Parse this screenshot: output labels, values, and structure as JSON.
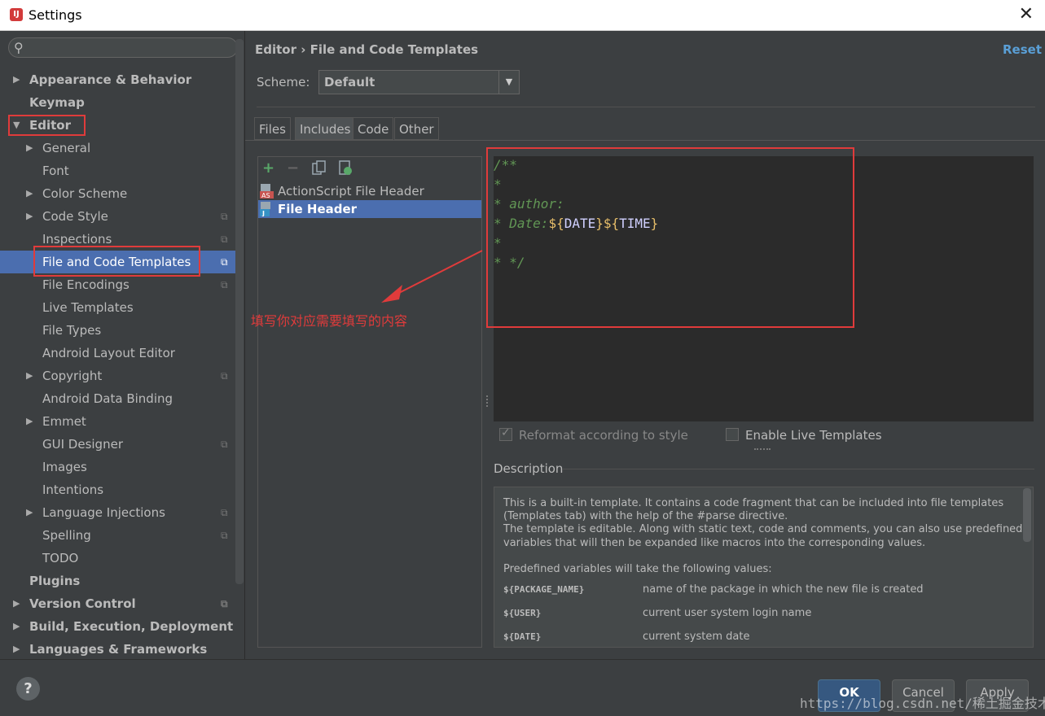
{
  "window": {
    "title": "Settings",
    "close_glyph": "✕"
  },
  "search": {
    "placeholder": ""
  },
  "sidebar": {
    "items": [
      {
        "label": "Appearance & Behavior",
        "arrow": "▶"
      },
      {
        "label": "Keymap"
      },
      {
        "label": "Editor",
        "arrow": "▼"
      },
      {
        "label": "General",
        "arrow": "▶"
      },
      {
        "label": "Font"
      },
      {
        "label": "Color Scheme",
        "arrow": "▶"
      },
      {
        "label": "Code Style",
        "arrow": "▶"
      },
      {
        "label": "Inspections"
      },
      {
        "label": "File and Code Templates"
      },
      {
        "label": "File Encodings"
      },
      {
        "label": "Live Templates"
      },
      {
        "label": "File Types"
      },
      {
        "label": "Android Layout Editor"
      },
      {
        "label": "Copyright",
        "arrow": "▶"
      },
      {
        "label": "Android Data Binding"
      },
      {
        "label": "Emmet",
        "arrow": "▶"
      },
      {
        "label": "GUI Designer"
      },
      {
        "label": "Images"
      },
      {
        "label": "Intentions"
      },
      {
        "label": "Language Injections",
        "arrow": "▶"
      },
      {
        "label": "Spelling"
      },
      {
        "label": "TODO"
      },
      {
        "label": "Plugins"
      },
      {
        "label": "Version Control",
        "arrow": "▶"
      },
      {
        "label": "Build, Execution, Deployment",
        "arrow": "▶"
      },
      {
        "label": "Languages & Frameworks",
        "arrow": "▶"
      }
    ]
  },
  "header": {
    "breadcrumb": "Editor › File and Code Templates",
    "reset_label": "Reset"
  },
  "scheme": {
    "label": "Scheme:",
    "value": "Default"
  },
  "tabs": [
    {
      "label": "Files"
    },
    {
      "label": "Includes"
    },
    {
      "label": "Code"
    },
    {
      "label": "Other"
    }
  ],
  "template_list": [
    {
      "label": "ActionScript File Header",
      "icon_text": "AS"
    },
    {
      "label": "File Header",
      "icon_text": "J"
    }
  ],
  "editor": {
    "line1": "/**",
    "line2": "*",
    "line3": "* author:",
    "line4_prefix": "* Date:",
    "line4_var1": "${",
    "line4_name1": "DATE",
    "line4_close1": "}",
    "line4_var2": "${",
    "line4_name2": "TIME",
    "line4_close2": "}",
    "line5": "*",
    "line6": "* */"
  },
  "options": {
    "reformat_label": "Reformat according to style",
    "live_templates_label": "Enable Live Templates"
  },
  "description": {
    "title": "Description",
    "p1": "This is a built-in template. It contains a code fragment that can be included into file templates",
    "p2": "(Templates tab) with the help of the #parse directive.",
    "p3": "The template is editable. Along with static text, code and comments, you can also use predefined",
    "p4": "variables that will then be expanded like macros into the corresponding values.",
    "p5": "Predefined variables will take the following values:",
    "vars": [
      {
        "key": "${PACKAGE_NAME}",
        "desc": "name of the package in which the new file is created"
      },
      {
        "key": "${USER}",
        "desc": "current user system login name"
      },
      {
        "key": "${DATE}",
        "desc": "current system date"
      }
    ]
  },
  "annotation": {
    "text": "填写你对应需要填写的内容"
  },
  "buttons": {
    "help": "?",
    "ok": "OK",
    "cancel": "Cancel",
    "apply": "Apply"
  },
  "watermark": "https://blog.csdn.net/稀土掘金技术社区",
  "colors": {
    "accent": "#4b6eaf",
    "annotation_red": "#e03b3b",
    "reset_blue": "#5a9fd6"
  }
}
